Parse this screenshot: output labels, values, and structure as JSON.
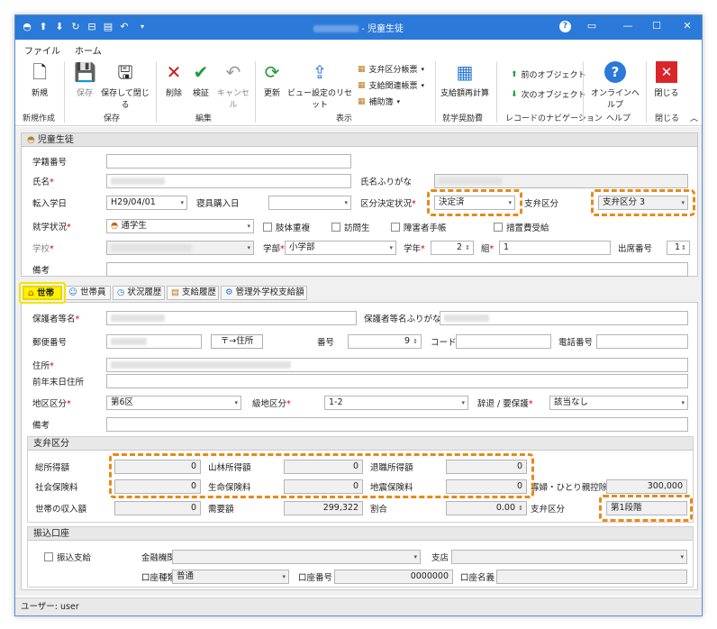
{
  "window": {
    "title": "- 児童生徒",
    "help_icon": "question-icon",
    "minimize": "—",
    "maximize": "☐",
    "close": "✕"
  },
  "ribbon_tabs": {
    "file": "ファイル",
    "home": "ホーム"
  },
  "ribbon": {
    "new": "新規",
    "save": "保存",
    "save_close": "保存して閉じる",
    "delete": "削除",
    "verify": "検証",
    "cancel": "キャンセル",
    "refresh": "更新",
    "view_reset": "ビュー設定のリセット",
    "shiben_form": "支弁区分帳票",
    "shikyu_form": "支給関連帳票",
    "supplement": "補助簿",
    "recalc": "支給額再計算",
    "prev_obj": "前のオブジェクト",
    "next_obj": "次のオブジェクト",
    "online_help": "オンラインヘルプ",
    "close": "閉じる",
    "group_new": "新規作成",
    "group_save": "保存",
    "group_edit": "編集",
    "group_view": "表示",
    "group_scholar": "就学奨励費",
    "group_nav": "レコードのナビゲーション",
    "group_help": "ヘルプ",
    "group_close": "閉じる"
  },
  "student": {
    "section": "児童生徒",
    "gakuseki_label": "学籍番号",
    "name_label": "氏名",
    "kana_label": "氏名ふりがな",
    "transfer_date_label": "転入学日",
    "transfer_date": "H29/04/01",
    "ryohin_label": "寝具購入日",
    "decision_label": "区分決定状況",
    "decision_value": "決定済",
    "shiben_label": "支弁区分",
    "shiben_value": "支弁区分 3",
    "status_label": "就学状況",
    "status_value": "通学生",
    "check_naiko": "肢体重複",
    "check_homon": "訪問生",
    "check_shogai": "障害者手帳",
    "check_sochi": "措置費受給",
    "school_label": "学校",
    "dept_label": "学部",
    "dept_value": "小学部",
    "grade_label": "学年",
    "grade_value": "2",
    "class_label": "組",
    "class_value": "1",
    "seat_label": "出席番号",
    "seat_value": "1",
    "remarks_label": "備考"
  },
  "tabs": [
    "世帯",
    "世帯員",
    "状況履歴",
    "支給履歴",
    "管理外学校支給額"
  ],
  "household": {
    "guardian_label": "保護者等名",
    "guardian_kana_label": "保護者等名ふりがな",
    "zip_label": "郵便番号",
    "zip_btn": "〒→住所",
    "bangou_label": "番号",
    "bangou_value": "9",
    "code_label": "コード",
    "phone_label": "電話番号",
    "address_label": "住所",
    "prev_address_label": "前年末日住所",
    "region_label": "地区区分",
    "region_value": "第6区",
    "grade_region_label": "級地区分",
    "grade_region_value": "1-2",
    "withdraw_label": "辞退 / 要保護",
    "withdraw_value": "該当なし",
    "remarks_label": "備考"
  },
  "shiben": {
    "section": "支弁区分",
    "total_income_label": "総所得額",
    "total_income": "0",
    "forest_label": "山林所得額",
    "forest": "0",
    "retire_label": "退職所得額",
    "retire": "0",
    "social_label": "社会保険料",
    "social": "0",
    "life_label": "生命保険料",
    "life": "0",
    "quake_label": "地震保険料",
    "quake": "0",
    "widow_label": "寡婦・ひとり親控除額",
    "widow": "300,000",
    "hh_income_label": "世帯の収入額",
    "hh_income": "0",
    "need_label": "需要額",
    "need": "299,322",
    "ratio_label": "割合",
    "ratio": "0.00",
    "shiben_label": "支弁区分",
    "shiben_value": "第1段階"
  },
  "transfer": {
    "section": "振込口座",
    "check": "振込支給",
    "bank_label": "金融機関",
    "branch_label": "支店",
    "acct_type_label": "口座種類",
    "acct_type": "普通",
    "acct_no_label": "口座番号",
    "acct_no": "0000000",
    "acct_name_label": "口座名義"
  },
  "status": {
    "user": "ユーザー: user"
  },
  "colors": {
    "titlebar": "#2b79d8",
    "highlight": "#e68a1a",
    "active_tab": "#fff200"
  }
}
